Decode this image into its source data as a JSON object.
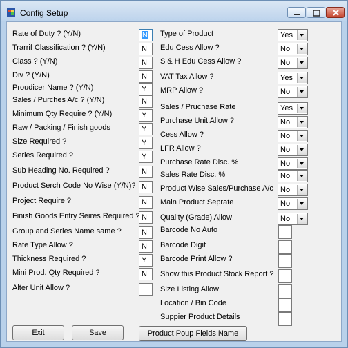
{
  "window": {
    "title": "Config Setup",
    "icon": "app-icon"
  },
  "left": {
    "items": [
      {
        "label": "Rate of Duty  ?  (Y/N)",
        "value": "N"
      },
      {
        "label": "Trarrif Classification ? (Y/N)",
        "value": "N"
      },
      {
        "label": "Class ? (Y/N)",
        "value": "N"
      },
      {
        "label": "Div ? (Y/N)",
        "value": "N"
      },
      {
        "label": "Proudicer Name ? (Y/N)",
        "value": "Y"
      },
      {
        "label": "Sales / Purches A/c ? (Y/N)",
        "value": "N"
      },
      {
        "label": "Minimum Qty Require ? (Y/N)",
        "value": "Y"
      },
      {
        "label": "Raw / Packing / Finish goods",
        "value": "Y"
      },
      {
        "label": "Size Required ?",
        "value": "Y"
      },
      {
        "label": "Series Required ?",
        "value": "Y"
      },
      {
        "label": "Sub Heading No. Required ?",
        "value": "N"
      },
      {
        "label": "Product Serch Code No Wise (Y/N)?",
        "value": "N"
      },
      {
        "label": "Project Require ?",
        "value": "N"
      },
      {
        "label": "Finish Goods Entry Seires Required ?",
        "value": "N"
      },
      {
        "label": "Group and Series Name same ?",
        "value": "N"
      },
      {
        "label": "Rate Type Allow ?",
        "value": "N"
      },
      {
        "label": "Thickness Required  ?",
        "value": "Y"
      },
      {
        "label": "Mini Prod. Qty Required ?",
        "value": "N"
      },
      {
        "label": "Alter Unit Allow ?",
        "value": ""
      }
    ]
  },
  "right": {
    "combos": [
      {
        "label": "Type of Product",
        "value": "Yes"
      },
      {
        "label": "Edu Cess Allow ?",
        "value": "No"
      },
      {
        "label": "S & H Edu Cess Allow ?",
        "value": "No"
      },
      {
        "label": "VAT Tax Allow ?",
        "value": "Yes"
      },
      {
        "label": "MRP Allow ?",
        "value": "No"
      },
      {
        "label": "Sales / Pruchase Rate",
        "value": "Yes"
      },
      {
        "label": "Purchase Unit Allow ?",
        "value": "No"
      },
      {
        "label": "Cess Allow ?",
        "value": "No"
      },
      {
        "label": "LFR Allow ?",
        "value": "No"
      },
      {
        "label": "Purchase Rate Disc. %",
        "value": "No"
      },
      {
        "label": "Sales Rate Disc. %",
        "value": "No"
      },
      {
        "label": "Product Wise Sales/Purchase A/c",
        "value": "No"
      },
      {
        "label": "Main Product Seprate",
        "value": "No"
      },
      {
        "label": "Quality (Grade) Allow",
        "value": "No"
      }
    ],
    "checks": [
      {
        "label": "Barcode No Auto"
      },
      {
        "label": "Barcode Digit"
      },
      {
        "label": "Barcode Print Allow ?"
      },
      {
        "label": "Show this Product Stock Report ?"
      },
      {
        "label": "Size Listing Allow"
      },
      {
        "label": "Location / Bin Code"
      },
      {
        "label": "Suppier Product Details"
      }
    ]
  },
  "buttons": {
    "exit": "Exit",
    "save": "Save",
    "popup": "Product Poup Fields Name"
  }
}
